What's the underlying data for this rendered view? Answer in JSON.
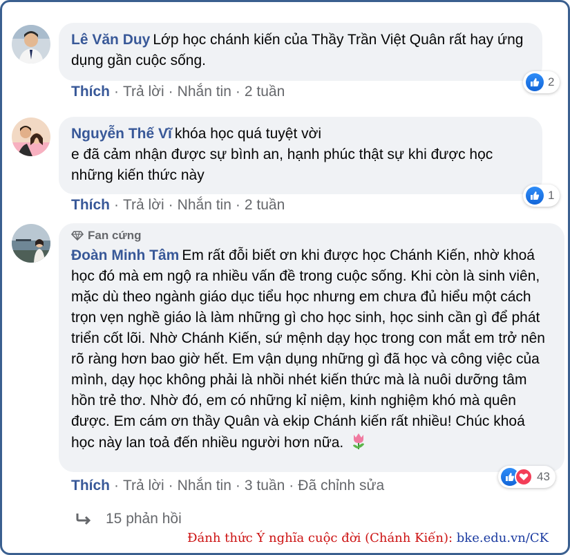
{
  "comments": [
    {
      "author": "Lê Văn Duy",
      "text": "Lớp học chánh kiến của Thầy Trần Việt Quân rất hay ứng dụng gần cuộc sống.",
      "actions": {
        "like": "Thích",
        "reply": "Trả lời",
        "message": "Nhắn tin",
        "time": "2 tuần"
      },
      "reaction_count": "2"
    },
    {
      "author": "Nguyễn Thế Vĩ",
      "text_line1": "khóa học quá tuyệt vời",
      "text_rest": "e đã cảm nhận được sự bình an, hạnh phúc thật sự khi được học những kiến thức này",
      "actions": {
        "like": "Thích",
        "reply": "Trả lời",
        "message": "Nhắn tin",
        "time": "2 tuần"
      },
      "reaction_count": "1"
    },
    {
      "badge": "Fan cứng",
      "author": "Đoàn Minh Tâm",
      "text": "Em rất đỗi biết ơn khi được học Chánh Kiến, nhờ khoá học đó mà em ngộ ra nhiều vấn đề trong cuộc sống. Khi còn là sinh viên, mặc dù theo ngành giáo dục tiểu học nhưng em chưa đủ hiểu một cách trọn vẹn nghề giáo là làm những gì cho học sinh, học sinh cần gì để phát triển cốt lõi. Nhờ Chánh Kiến, sứ mệnh dạy học trong con mắt em trở nên rõ ràng hơn bao giờ hết. Em vận dụng những gì đã học và công việc của mình, dạy học không phải là nhồi nhét kiến thức mà là nuôi dưỡng tâm hồn trẻ thơ. Nhờ đó, em có những kỉ niệm, kinh nghiệm khó mà quên được. Em cám ơn thầy Quân và ekip Chánh kiến rất nhiều! Chúc khoá học này lan toả đến nhiều người hơn nữa.",
      "actions": {
        "like": "Thích",
        "reply": "Trả lời",
        "message": "Nhắn tin",
        "time": "3 tuần",
        "edited": "Đã chỉnh sửa"
      },
      "reaction_count": "43"
    }
  ],
  "replies_label": "15 phản hồi",
  "footer": {
    "label": "Đánh thức Ý nghĩa cuộc đời (Chánh Kiến):",
    "link": "bke.edu.vn/CK"
  },
  "colors": {
    "link_blue": "#385898",
    "bubble_bg": "#f0f2f5",
    "like_blue": "#1877f2",
    "love_red": "#f33e58",
    "frame_border": "#3a5f8f"
  },
  "icons": [
    "like-icon",
    "love-icon",
    "diamond-icon",
    "reply-arrow-icon",
    "tulip-icon"
  ]
}
